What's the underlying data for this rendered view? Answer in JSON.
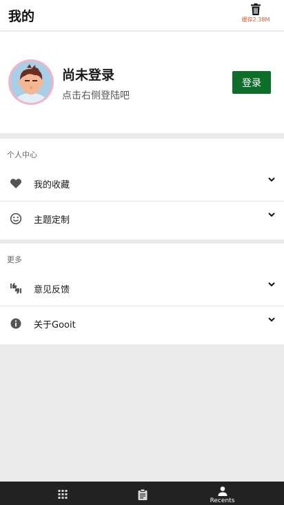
{
  "header": {
    "title": "我的",
    "cache_label": "缓存2.38M",
    "cache_color": "#e8572b"
  },
  "profile": {
    "name": "尚未登录",
    "hint": "点击右侧登陆吧",
    "login_label": "登录",
    "login_color": "#0d6e2a"
  },
  "personal": {
    "title": "个人中心",
    "items": [
      {
        "label": "我的收藏",
        "icon": "heart-icon"
      },
      {
        "label": "主题定制",
        "icon": "smiley-icon"
      }
    ]
  },
  "more": {
    "title": "更多",
    "items": [
      {
        "label": "意见反馈",
        "icon": "thumbs-icon"
      },
      {
        "label": "关于Gooit",
        "icon": "info-icon"
      }
    ]
  },
  "bottom_nav": {
    "items": [
      {
        "icon": "apps-grid-icon",
        "label": ""
      },
      {
        "icon": "clipboard-icon",
        "label": ""
      },
      {
        "icon": "person-icon",
        "label": "Recents"
      }
    ]
  }
}
